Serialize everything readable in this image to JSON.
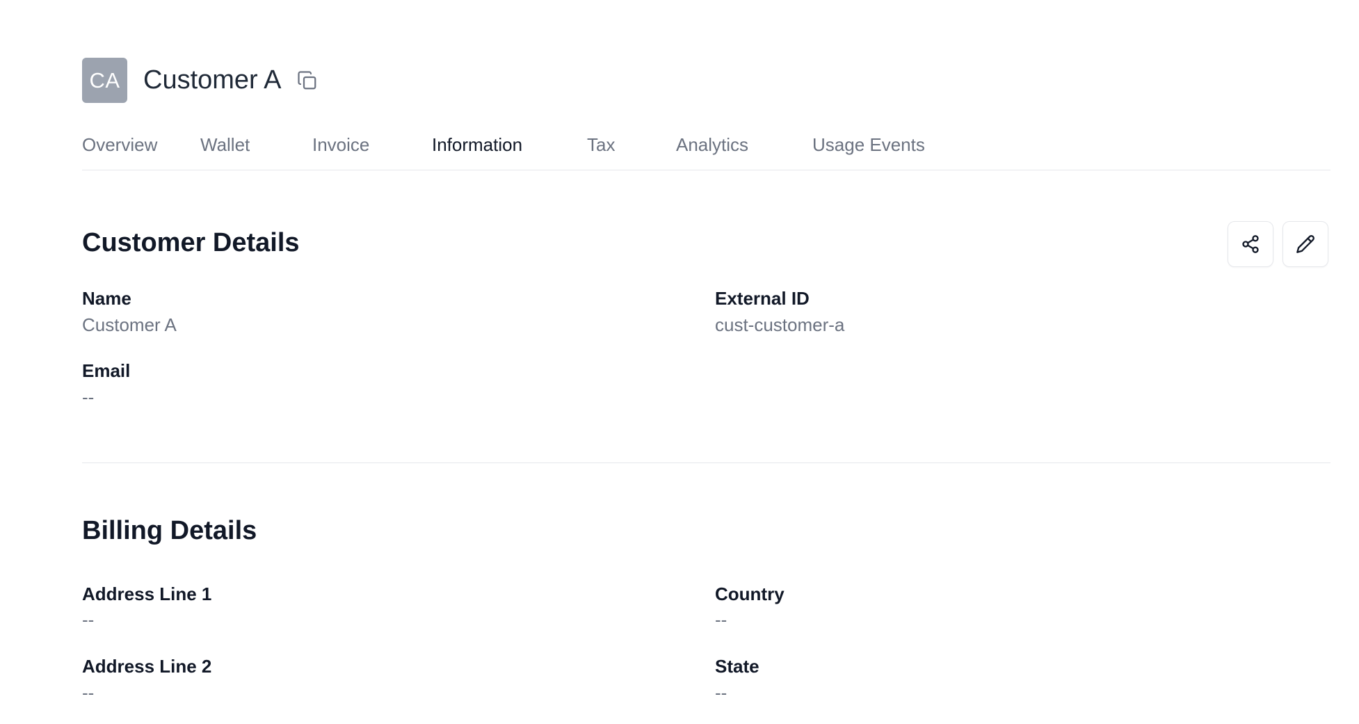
{
  "customer": {
    "initials": "CA",
    "name": "Customer A"
  },
  "tabs": [
    {
      "label": "Overview",
      "active": false
    },
    {
      "label": "Wallet",
      "active": false
    },
    {
      "label": "Invoice",
      "active": false
    },
    {
      "label": "Information",
      "active": true
    },
    {
      "label": "Tax",
      "active": false
    },
    {
      "label": "Analytics",
      "active": false
    },
    {
      "label": "Usage Events",
      "active": false
    }
  ],
  "customer_details": {
    "title": "Customer Details",
    "fields": {
      "name": {
        "label": "Name",
        "value": "Customer A"
      },
      "external_id": {
        "label": "External ID",
        "value": "cust-customer-a"
      },
      "email": {
        "label": "Email",
        "value": "--"
      }
    },
    "actions": {
      "share_icon": "share-icon",
      "edit_icon": "pencil-icon"
    }
  },
  "billing_details": {
    "title": "Billing Details",
    "fields": {
      "address_line_1": {
        "label": "Address Line 1",
        "value": "--"
      },
      "address_line_2": {
        "label": "Address Line 2",
        "value": "--"
      },
      "country": {
        "label": "Country",
        "value": "--"
      },
      "state": {
        "label": "State",
        "value": "--"
      }
    }
  },
  "colors": {
    "avatar_bg": "#9ca3af",
    "muted_text": "#6b7280",
    "border": "#e5e7eb"
  }
}
